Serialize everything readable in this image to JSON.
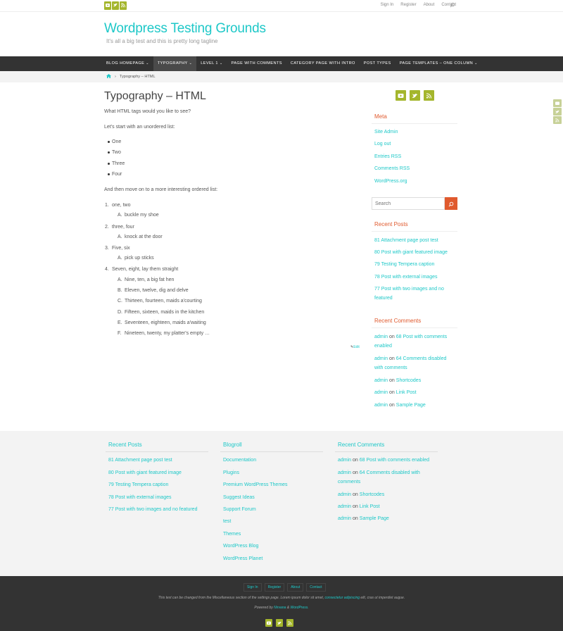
{
  "topbar": {
    "menu": [
      "Sign In",
      "Register",
      "About",
      "Contact"
    ],
    "social_icons": [
      "youtube-icon",
      "twitter-icon",
      "rss-icon"
    ]
  },
  "header": {
    "title": "Wordpress Testing Grounds",
    "tagline": "It's all a big test and this is pretty long tagline"
  },
  "nav": {
    "items": [
      {
        "label": "BLOG HOMEPAGE",
        "has_caret": true
      },
      {
        "label": "TYPOGRAPHY",
        "has_caret": true
      },
      {
        "label": "LEVEL 1",
        "has_caret": true
      },
      {
        "label": "PAGE WITH COMMENTS",
        "has_caret": false
      },
      {
        "label": "CATEGORY PAGE WITH INTRO",
        "has_caret": false
      },
      {
        "label": "POST TYPES",
        "has_caret": false
      },
      {
        "label": "PAGE TEMPLATES – ONE COLUMN",
        "has_caret": true
      }
    ],
    "active_index": 1
  },
  "breadcrumbs": {
    "separator": "›",
    "current": "Typography – HTML"
  },
  "post": {
    "title": "Typography – HTML",
    "intro": "What HTML tags would you like to see?",
    "ul_intro": "Let's start with an unordered list:",
    "ul_items": [
      "One",
      "Two",
      "Three",
      "Four"
    ],
    "ol_intro": "And then move on to a more interesting ordered list:",
    "ol_items": [
      {
        "num": "1.",
        "text": "one, two",
        "sub": [
          {
            "letter": "A.",
            "text": "buckle my shoe"
          }
        ]
      },
      {
        "num": "2.",
        "text": "three, four",
        "sub": [
          {
            "letter": "A.",
            "text": "knock at the door"
          }
        ]
      },
      {
        "num": "3.",
        "text": "Five, six",
        "sub": [
          {
            "letter": "A.",
            "text": "pick up sticks"
          }
        ]
      },
      {
        "num": "4.",
        "text": "Seven, eight, lay them straight",
        "sub": [
          {
            "letter": "A.",
            "text": "Nine, ten, a big fat hen"
          },
          {
            "letter": "B.",
            "text": "Eleven, twelve, dig and delve"
          },
          {
            "letter": "C.",
            "text": "Thirteen, fourteen, maids a'courting"
          },
          {
            "letter": "D.",
            "text": "Fifteen, sixteen, maids in the kitchen"
          },
          {
            "letter": "E.",
            "text": "Seventeen, eighteen, maids a'waiting"
          },
          {
            "letter": "F.",
            "text": "Nineteen, twenty, my platter's empty …"
          }
        ]
      }
    ],
    "edit_label": "Edit"
  },
  "sidebar": {
    "meta_title": "Meta",
    "meta_links": [
      "Site Admin",
      "Log out",
      "Entries RSS",
      "Comments RSS",
      "WordPress.org"
    ],
    "search_placeholder": "Search",
    "recent_posts_title": "Recent Posts",
    "recent_posts": [
      "81 Attachment page post test",
      "80 Post with giant featured image",
      "79 Testing Tempera caption",
      "78 Post with external images",
      "77 Post with two images and no featured"
    ],
    "recent_comments_title": "Recent Comments",
    "recent_comments": [
      {
        "author": "admin",
        "on": "on",
        "post": "68 Post with comments enabled"
      },
      {
        "author": "admin",
        "on": "on",
        "post": "64 Comments disabled with comments"
      },
      {
        "author": "admin",
        "on": "on",
        "post": "Shortcodes"
      },
      {
        "author": "admin",
        "on": "on",
        "post": "Link Post"
      },
      {
        "author": "admin",
        "on": "on",
        "post": "Sample Page"
      }
    ]
  },
  "footer_widgets": {
    "recent_posts_title": "Recent Posts",
    "recent_posts": [
      "81 Attachment page post test",
      "80 Post with giant featured image",
      "79 Testing Tempera caption",
      "78 Post with external images",
      "77 Post with two images and no featured"
    ],
    "blogroll_title": "Blogroll",
    "blogroll": [
      "Documentation",
      "Plugins",
      "Premium WordPress Themes",
      "Suggest Ideas",
      "Support Forum",
      "test",
      "Themes",
      "WordPress Blog",
      "WordPress Planet"
    ],
    "recent_comments_title": "Recent Comments",
    "recent_comments": [
      {
        "author": "admin",
        "on": "on",
        "post": "68 Post with comments enabled"
      },
      {
        "author": "admin",
        "on": "on",
        "post": "64 Comments disabled with comments"
      },
      {
        "author": "admin",
        "on": "on",
        "post": "Shortcodes"
      },
      {
        "author": "admin",
        "on": "on",
        "post": "Link Post"
      },
      {
        "author": "admin",
        "on": "on",
        "post": "Sample Page"
      }
    ]
  },
  "footer": {
    "menu": [
      "Sign In",
      "Register",
      "About",
      "Contact"
    ],
    "text_before": "This text can be changed from the Miscellaneous section of the settings page. Lorem ipsum dolor sit amet, ",
    "text_link": "consectetur adipiscing",
    "text_after": " elit, cras ut imperdiet augue.",
    "powered_by": "Powered by",
    "theme_link": "Nirvana",
    "and": "&",
    "wp_link": "WordPress."
  },
  "colors": {
    "accent": "#1EC8C8",
    "widget_title": "#E05A2E",
    "social": "#A4B62C",
    "nav_bg": "#333333"
  }
}
